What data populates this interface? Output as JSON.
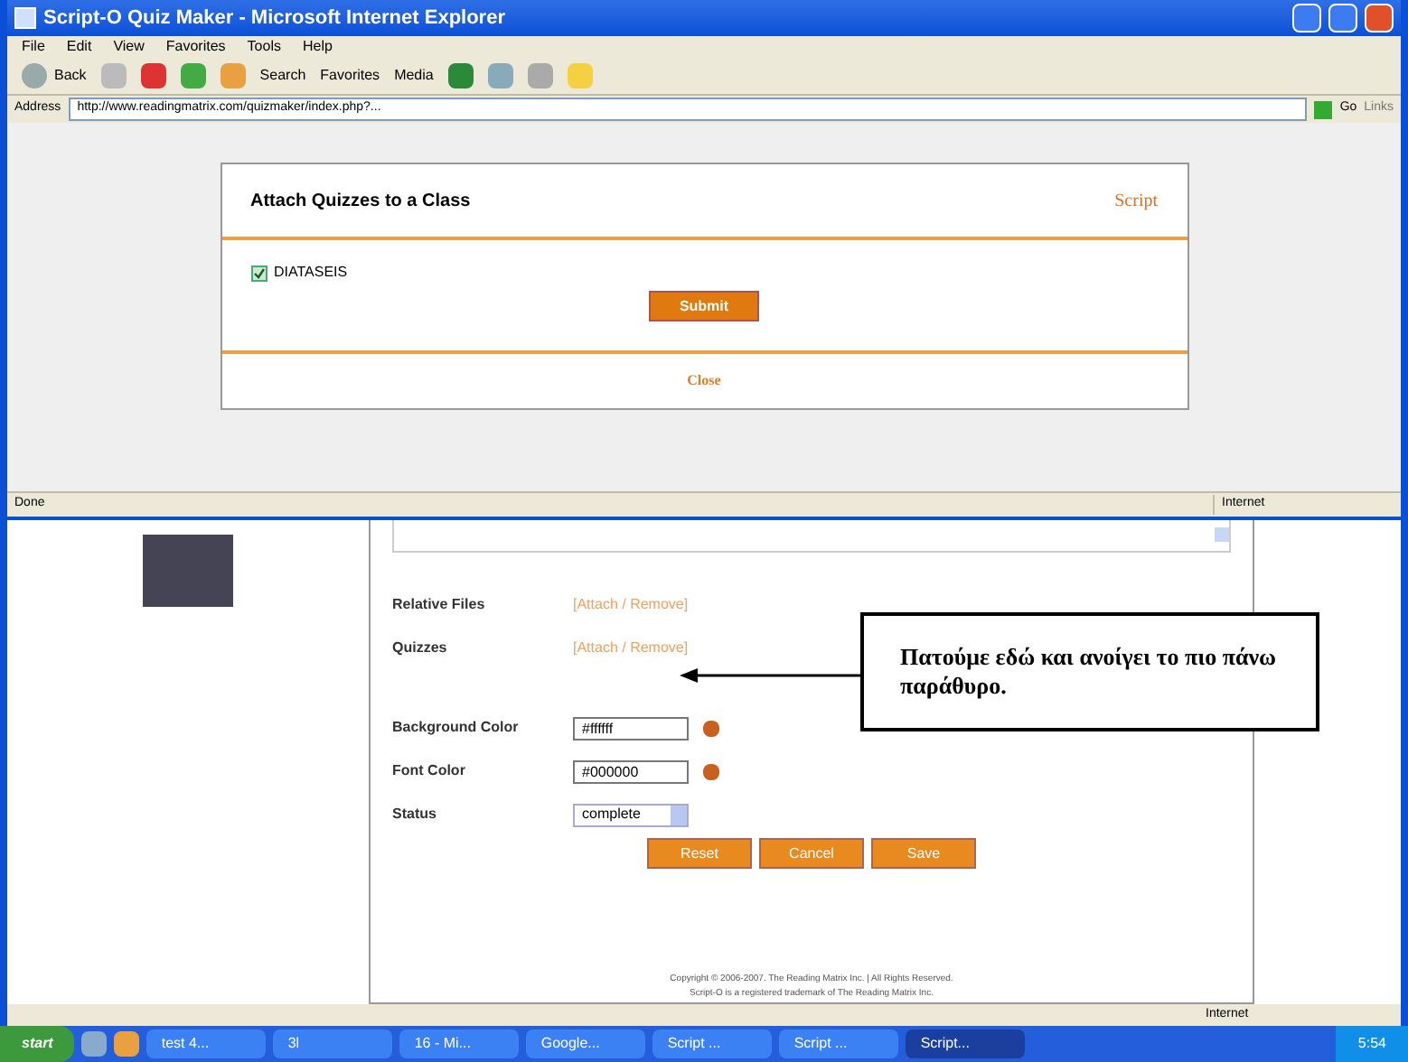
{
  "popup_window": {
    "title": "Script-O Quiz Maker - Microsoft Internet Explorer",
    "menu": [
      "File",
      "Edit",
      "View",
      "Favorites",
      "Tools",
      "Help"
    ],
    "toolbar": {
      "back": "Back",
      "search": "Search",
      "favorites": "Favorites",
      "media": "Media"
    },
    "address": {
      "label": "Address",
      "url": "http://www.readingmatrix.com/quizmaker/index.php?...",
      "go": "Go",
      "links": "Links"
    },
    "dialog": {
      "title": "Attach Quizzes to a Class",
      "logo": "Script",
      "classes": [
        {
          "label": "DIATASEIS",
          "checked": true
        }
      ],
      "submit": "Submit",
      "close": "Close"
    },
    "status_bar": {
      "status": "Done",
      "zone": "Internet"
    }
  },
  "page": {
    "fields": [
      {
        "kind": "link",
        "label": "Relative Files",
        "value": "[Attach / Remove]"
      },
      {
        "kind": "link",
        "label": "Quizzes",
        "value": "[Attach / Remove]"
      },
      {
        "kind": "spacer"
      },
      {
        "kind": "color",
        "label": "Background Color",
        "value": "#ffffff"
      },
      {
        "kind": "color",
        "label": "Font Color",
        "value": "#000000"
      },
      {
        "kind": "select",
        "label": "Status",
        "value": "complete"
      }
    ],
    "buttons": [
      "Reset",
      "Cancel",
      "Save"
    ],
    "callout": "Πατούμε εδώ και ανοίγει το πιο πάνω παράθυρο.",
    "footer": [
      "Copyright © 2006-2007. The Reading Matrix Inc. | All Rights Reserved.",
      "Script-O is a registered trademark of The Reading Matrix Inc."
    ]
  },
  "status_bar": {
    "zone": "Internet"
  },
  "taskbar": {
    "start": "start",
    "tasks": [
      {
        "label": "test 4...",
        "selected": false
      },
      {
        "label": "3l",
        "selected": false
      },
      {
        "label": "16 - Mi...",
        "selected": false
      },
      {
        "label": "Google...",
        "selected": false
      },
      {
        "label": "Script ...",
        "selected": false
      },
      {
        "label": "Script ...",
        "selected": false
      },
      {
        "label": "Script...",
        "selected": true
      }
    ],
    "clock": "5:54"
  }
}
